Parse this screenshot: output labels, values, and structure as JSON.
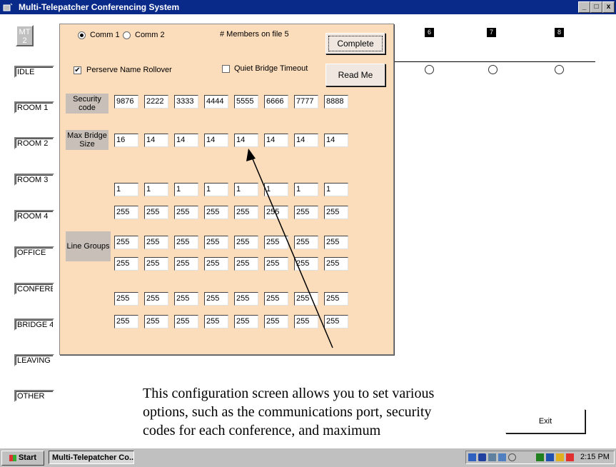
{
  "window": {
    "title": "Multi-Telepatcher Conferencing System",
    "buttons": [
      "_",
      "□",
      "x"
    ],
    "logo_text": "MT 2"
  },
  "sidebar": {
    "items": [
      {
        "label": "IDLE"
      },
      {
        "label": "ROOM 1"
      },
      {
        "label": "ROOM 2"
      },
      {
        "label": "ROOM 3"
      },
      {
        "label": "ROOM 4"
      },
      {
        "label": "OFFICE"
      },
      {
        "label": "CONFERENCE"
      },
      {
        "label": "BRIDGE 4"
      },
      {
        "label": "LEAVING"
      },
      {
        "label": "OTHER"
      }
    ]
  },
  "columns": {
    "numbers": [
      "6",
      "7",
      "8"
    ]
  },
  "config": {
    "comm1_label": "Comm 1",
    "comm2_label": "Comm 2",
    "comm_selected": "Comm 1",
    "members_text": "# Members on file 5",
    "complete_label": "Complete",
    "readme_label": "Read Me",
    "preserve_label": "Perserve Name Rollover",
    "preserve_checked": true,
    "quiet_label": "Quiet Bridge Timeout",
    "quiet_checked": false,
    "security_label": "Security code",
    "security_codes": [
      "9876",
      "2222",
      "3333",
      "4444",
      "5555",
      "6666",
      "7777",
      "8888"
    ],
    "maxbridge_label": "Max Bridge Size",
    "max_bridge_sizes": [
      "16",
      "14",
      "14",
      "14",
      "14",
      "14",
      "14",
      "14"
    ],
    "line_groups_label": "Line Groups",
    "line_group_rows": [
      [
        "1",
        "1",
        "1",
        "1",
        "1",
        "1",
        "1",
        "1"
      ],
      [
        "255",
        "255",
        "255",
        "255",
        "255",
        "255",
        "255",
        "255"
      ],
      [
        "255",
        "255",
        "255",
        "255",
        "255",
        "255",
        "255",
        "255"
      ],
      [
        "255",
        "255",
        "255",
        "255",
        "255",
        "255",
        "255",
        "255"
      ],
      [
        "255",
        "255",
        "255",
        "255",
        "255",
        "255",
        "255",
        "255"
      ],
      [
        "255",
        "255",
        "255",
        "255",
        "255",
        "255",
        "255",
        "255"
      ]
    ]
  },
  "exit_label": "Exit",
  "caption": "This configuration screen allows you to set various options, such as the communications port, security codes for each conference, and maximum",
  "taskbar": {
    "start_label": "Start",
    "task_label": "Multi-Telepatcher Co...",
    "clock": "2:15 PM"
  },
  "colors": {
    "titlebar": "#0a2a8a",
    "panel": "#fbdcbb",
    "label_grey": "#c8c0b8"
  }
}
